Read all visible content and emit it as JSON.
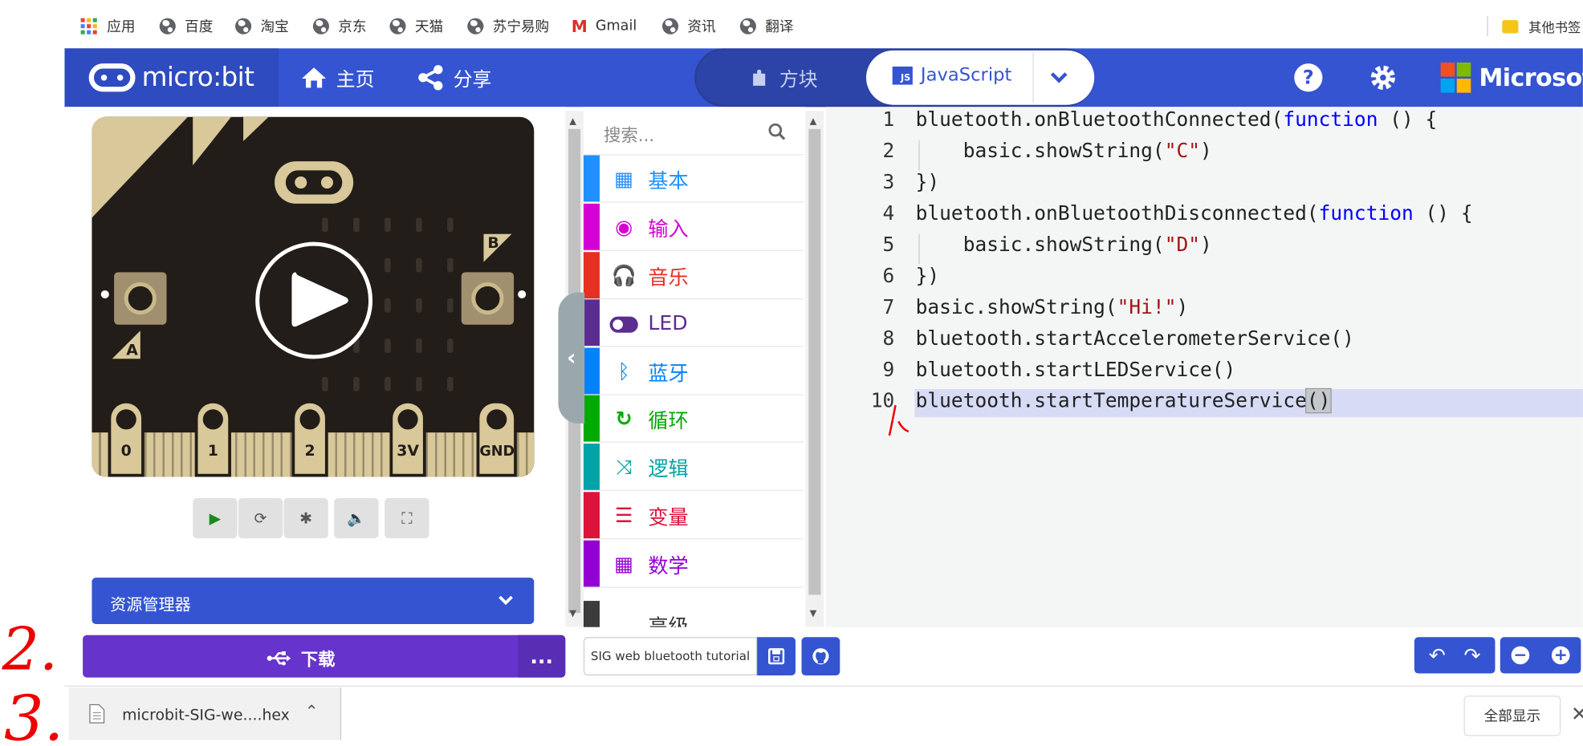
{
  "bookmarks": [
    {
      "label": "应用",
      "icon": "apps-grid-icon"
    },
    {
      "label": "百度",
      "icon": "globe-icon"
    },
    {
      "label": "淘宝",
      "icon": "globe-icon"
    },
    {
      "label": "京东",
      "icon": "globe-icon"
    },
    {
      "label": "天猫",
      "icon": "globe-icon"
    },
    {
      "label": "苏宁易购",
      "icon": "globe-icon"
    },
    {
      "label": "Gmail",
      "icon": "gmail-icon"
    },
    {
      "label": "资讯",
      "icon": "globe-icon"
    },
    {
      "label": "翻译",
      "icon": "globe-icon"
    },
    {
      "label": "其他书签",
      "icon": "folder-icon"
    }
  ],
  "header": {
    "brand": "micro:bit",
    "home": "主页",
    "share": "分享",
    "blocks": "方块",
    "javascript": "JavaScript",
    "microsoft": "Microsoft",
    "colors": {
      "header": "#3454d1",
      "download": "#6633cc"
    }
  },
  "simulator": {
    "pins": [
      "0",
      "1",
      "2",
      "3V",
      "GND"
    ],
    "button_a": "A",
    "button_b": "B",
    "controls": [
      "play-icon",
      "restart-icon",
      "debug-icon",
      "sound-icon",
      "fullscreen-icon"
    ]
  },
  "explorer": "资源管理器",
  "search_placeholder": "搜索...",
  "toolbox": [
    {
      "label": "基本",
      "color": "#1e90ff",
      "icon": "grid-icon"
    },
    {
      "label": "输入",
      "color": "#d400d4",
      "icon": "target-icon"
    },
    {
      "label": "音乐",
      "color": "#e63022",
      "icon": "headphones-icon"
    },
    {
      "label": "LED",
      "color": "#5c2d91",
      "icon": "toggle-icon"
    },
    {
      "label": "蓝牙",
      "color": "#0082fb",
      "icon": "bluetooth-icon"
    },
    {
      "label": "循环",
      "color": "#00aa00",
      "icon": "loop-icon"
    },
    {
      "label": "逻辑",
      "color": "#00a4a6",
      "icon": "shuffle-icon"
    },
    {
      "label": "变量",
      "color": "#dc143c",
      "icon": "lines-icon"
    },
    {
      "label": "数学",
      "color": "#9400d3",
      "icon": "calculator-icon"
    },
    {
      "label": "高级",
      "color": "#3c3c3c",
      "icon": "chevron-icon"
    }
  ],
  "code": {
    "line_numbers": [
      "1",
      "2",
      "3",
      "4",
      "5",
      "6",
      "7",
      "8",
      "9",
      "10"
    ],
    "lines": [
      [
        [
          "bluetooth.onBluetoothConnected(",
          ""
        ],
        [
          "function",
          "kw"
        ],
        [
          " () {",
          ""
        ]
      ],
      [
        [
          "    basic.showString(",
          ""
        ],
        [
          "\"C\"",
          "str"
        ],
        [
          ")",
          ""
        ]
      ],
      [
        [
          "})",
          ""
        ]
      ],
      [
        [
          "bluetooth.onBluetoothDisconnected(",
          ""
        ],
        [
          "function",
          "kw"
        ],
        [
          " () {",
          ""
        ]
      ],
      [
        [
          "    basic.showString(",
          ""
        ],
        [
          "\"D\"",
          "str"
        ],
        [
          ")",
          ""
        ]
      ],
      [
        [
          "})",
          ""
        ]
      ],
      [
        [
          "basic.showString(",
          ""
        ],
        [
          "\"Hi!\"",
          "str"
        ],
        [
          ")",
          ""
        ]
      ],
      [
        [
          "bluetooth.startAccelerometerService()",
          ""
        ]
      ],
      [
        [
          "bluetooth.startLEDService()",
          ""
        ]
      ],
      [
        [
          "bluetooth.startTemperatureService",
          ""
        ],
        [
          "()",
          "hl"
        ]
      ]
    ]
  },
  "bottom": {
    "download": "下载",
    "more": "...",
    "project_name": "SIG web bluetooth tutorial"
  },
  "shelf": {
    "file": "microbit-SIG-we....hex",
    "show_all": "全部显示"
  },
  "annotations": [
    "1",
    "2.",
    "3."
  ]
}
